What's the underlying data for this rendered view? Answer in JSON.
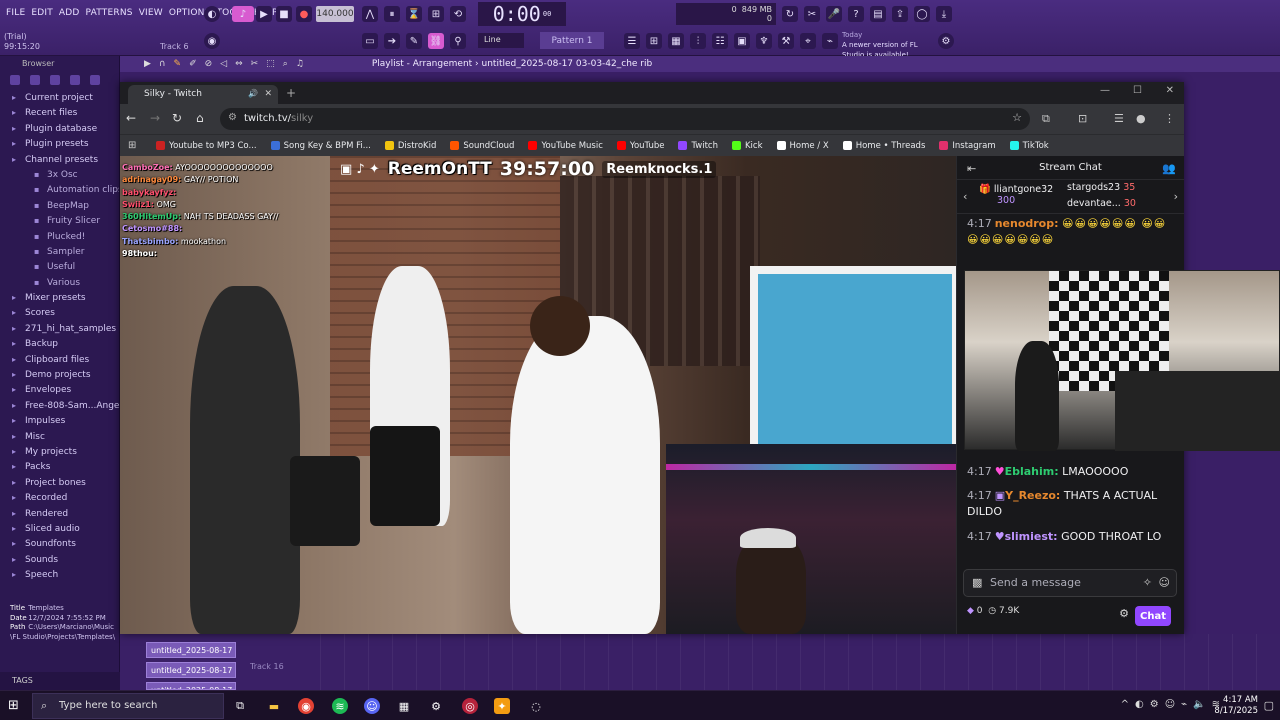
{
  "fl": {
    "menu": [
      "FILE",
      "EDIT",
      "ADD",
      "PATTERNS",
      "VIEW",
      "OPTIONS",
      "TOOLS",
      "HELP"
    ],
    "trial": "(Trial)",
    "trial_time": "99:15:20",
    "track_label": "Track 6",
    "bpm": "140.000",
    "time": "0:00",
    "time_small": "00",
    "memory": "849 MB",
    "mem_top": "0",
    "mem_bottom": "0",
    "snap_mode": "Line",
    "pattern": "Pattern 1",
    "news_date": "Today",
    "news_text": "A newer version of FL Studio is available!",
    "playlist_title": "Playlist - Arrangement",
    "playlist_file": "untitled_2025-08-17 03-03-42_che rib"
  },
  "browser": {
    "header": "Browser",
    "items": [
      {
        "label": "Current project",
        "sub": false
      },
      {
        "label": "Recent files",
        "sub": false
      },
      {
        "label": "Plugin database",
        "sub": false
      },
      {
        "label": "Plugin presets",
        "sub": false
      },
      {
        "label": "Channel presets",
        "sub": false
      },
      {
        "label": "3x Osc",
        "sub": true
      },
      {
        "label": "Automation clips",
        "sub": true
      },
      {
        "label": "BeepMap",
        "sub": true
      },
      {
        "label": "Fruity Slicer",
        "sub": true
      },
      {
        "label": "Plucked!",
        "sub": true
      },
      {
        "label": "Sampler",
        "sub": true
      },
      {
        "label": "Useful",
        "sub": true
      },
      {
        "label": "Various",
        "sub": true
      },
      {
        "label": "Mixer presets",
        "sub": false
      },
      {
        "label": "Scores",
        "sub": false
      },
      {
        "label": "271_hi_hat_samples",
        "sub": false
      },
      {
        "label": "Backup",
        "sub": false
      },
      {
        "label": "Clipboard files",
        "sub": false
      },
      {
        "label": "Demo projects",
        "sub": false
      },
      {
        "label": "Envelopes",
        "sub": false
      },
      {
        "label": "Free-808-Sam...AngelicVibes",
        "sub": false
      },
      {
        "label": "Impulses",
        "sub": false
      },
      {
        "label": "Misc",
        "sub": false
      },
      {
        "label": "My projects",
        "sub": false
      },
      {
        "label": "Packs",
        "sub": false
      },
      {
        "label": "Project bones",
        "sub": false
      },
      {
        "label": "Recorded",
        "sub": false
      },
      {
        "label": "Rendered",
        "sub": false
      },
      {
        "label": "Sliced audio",
        "sub": false
      },
      {
        "label": "Soundfonts",
        "sub": false
      },
      {
        "label": "Sounds",
        "sub": false
      },
      {
        "label": "Speech",
        "sub": false
      }
    ],
    "info_title_k": "Title",
    "info_title_v": "Templates",
    "info_date_k": "Date",
    "info_date_v": "12/7/2024 7:55:52 PM",
    "info_path_k": "Path",
    "info_path_v": "C:\\Users\\Marciano\\Music\\FL Studio\\Projects\\Templates\\",
    "tags": "TAGS"
  },
  "arrange": {
    "clips": [
      "untitled_2025-08-17 03-...",
      "untitled_2025-08-17 03-...",
      "untitled_2025-08-17 03-..."
    ],
    "track16": "Track 16"
  },
  "chrome": {
    "tab_title": "Silky - Twitch",
    "url_host": "twitch.tv/",
    "url_path": "silky",
    "bookmarks": [
      {
        "label": "Youtube to MP3 Co...",
        "color": "#cc2222"
      },
      {
        "label": "Song Key & BPM Fi...",
        "color": "#3b6fd8"
      },
      {
        "label": "DistroKid",
        "color": "#f1c40f"
      },
      {
        "label": "SoundCloud",
        "color": "#ff5500"
      },
      {
        "label": "YouTube Music",
        "color": "#ff0000"
      },
      {
        "label": "YouTube",
        "color": "#ff0000"
      },
      {
        "label": "Twitch",
        "color": "#9147ff"
      },
      {
        "label": "Kick",
        "color": "#53fc18"
      },
      {
        "label": "Home / X",
        "color": "#ffffff"
      },
      {
        "label": "Home • Threads",
        "color": "#ffffff"
      },
      {
        "label": "Instagram",
        "color": "#e1306c"
      },
      {
        "label": "TikTok",
        "color": "#25f4ee"
      }
    ]
  },
  "video": {
    "handle": "ReemOnTT",
    "timer": "39:57:00",
    "handle2": "Reemknocks.1",
    "overlay_chat": [
      {
        "user": "CamboZoe:",
        "msg": "AYOOOOOOOOOOOOOO",
        "color": "#ff6fb5"
      },
      {
        "user": "adrinagay09:",
        "msg": "GAY// POTION",
        "color": "#ff8a3d"
      },
      {
        "user": "babykayfyz:",
        "msg": "",
        "color": "#ff4f6d"
      },
      {
        "user": "Swiiz1:",
        "msg": "OMG",
        "color": "#ff4f6d"
      },
      {
        "user": "360HitemUp:",
        "msg": "NAH TS DEADASS GAY//",
        "color": "#2ecc71"
      },
      {
        "user": "Cetosmo#88:",
        "msg": "",
        "color": "#bf94ff"
      },
      {
        "user": "Thatsbimbo:",
        "msg": "mookathon",
        "color": "#9aa4ff"
      },
      {
        "user": "98thou:",
        "msg": "",
        "color": "#ffffff"
      }
    ]
  },
  "chat": {
    "title": "Stream Chat",
    "leader1_name": "lliantgone32",
    "leader1_val": "300",
    "leader2_name": "stargods23",
    "leader2_val": "35",
    "leader3_name": "devantae...",
    "leader3_val": "30",
    "m1_time": "4:17",
    "m1_user": "nenodrop:",
    "m2_time": "4:17",
    "m2_user": "Eblahim:",
    "m2_text": "LMAOOOOO",
    "m3_time": "4:17",
    "m3_user": "Y_Reezo:",
    "m3_text": "THATS A ACTUAL DILDO",
    "m4_time": "4:17",
    "m4_user": "slimiest:",
    "m4_text": "GOOD THROAT LO",
    "placeholder": "Send a message",
    "points": "0",
    "viewers": "7.9K",
    "chat_button": "Chat"
  },
  "taskbar": {
    "search_placeholder": "Type here to search",
    "time": "4:17 AM",
    "date": "8/17/2025"
  }
}
